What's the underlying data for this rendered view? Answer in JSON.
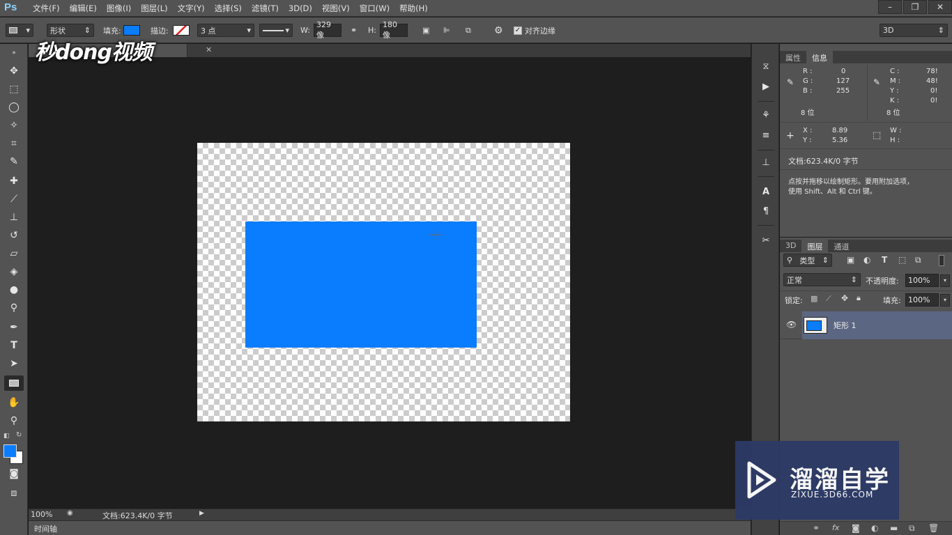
{
  "app": {
    "logo": "Ps"
  },
  "menu": [
    "文件(F)",
    "编辑(E)",
    "图像(I)",
    "图层(L)",
    "文字(Y)",
    "选择(S)",
    "滤镜(T)",
    "3D(D)",
    "视图(V)",
    "窗口(W)",
    "帮助(H)"
  ],
  "window_controls": {
    "minimize": "–",
    "restore": "❐",
    "close": "✕"
  },
  "options": {
    "mode": "形状",
    "fill_label": "填充:",
    "fill_color": "#0a7cfe",
    "stroke_label": "描边:",
    "stroke_size": "3 点",
    "w_label": "W:",
    "w_value": "329 像",
    "h_label": "H:",
    "h_value": "180 像",
    "align_edges": "对齐边缘",
    "workspace": "3D"
  },
  "watermark_logo": "秒dong视频",
  "document": {
    "shape_color": "#0a7cfe"
  },
  "status": {
    "zoom": "100%",
    "doc_info": "文档:623.4K/0 字节"
  },
  "timeline_label": "时间轴",
  "info_panel": {
    "tabs": [
      "属性",
      "信息"
    ],
    "active_tab": "信息",
    "rgb": {
      "r_label": "R :",
      "r": "0",
      "g_label": "G :",
      "g": "127",
      "b_label": "B :",
      "b": "255",
      "bit": "8 位"
    },
    "cmyk": {
      "c_label": "C :",
      "c": "78!",
      "m_label": "M :",
      "m": "48!",
      "y_label": "Y :",
      "y": "0!",
      "k_label": "K :",
      "k": "0!",
      "bit": "8 位"
    },
    "xy": {
      "x_label": "X :",
      "x": "8.89",
      "y_label": "Y :",
      "y": "5.36"
    },
    "wh": {
      "w_label": "W :",
      "h_label": "H :"
    },
    "doc": "文档:623.4K/0 字节",
    "hint_line1": "点按并拖移以绘制矩形。要用附加选项，",
    "hint_line2": "使用 Shift、Alt 和 Ctrl 键。"
  },
  "layers_panel": {
    "tabs": [
      "3D",
      "图层",
      "通道"
    ],
    "active_tab": "图层",
    "filter": "类型",
    "blend_mode": "正常",
    "opacity_label": "不透明度:",
    "opacity": "100%",
    "lock_label": "锁定:",
    "fill_label": "填充:",
    "fill": "100%",
    "layers": [
      {
        "name": "矩形 1"
      }
    ],
    "footer_icons": [
      "link-icon",
      "fx",
      "mask-icon",
      "adjustment-icon",
      "folder-icon",
      "new-layer-icon",
      "trash-icon"
    ]
  },
  "zixue": {
    "title": "溜溜自学",
    "url": "ZIXUE.3D66.COM"
  }
}
